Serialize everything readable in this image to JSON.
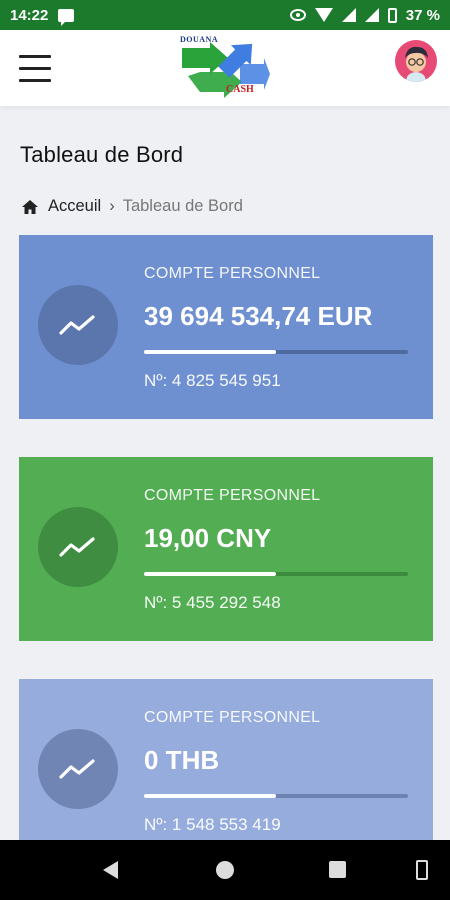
{
  "status_bar": {
    "time": "14:22",
    "battery": "37 %"
  },
  "header": {
    "logo_top": "DOUANA",
    "logo_bottom": "CASH"
  },
  "page": {
    "title": "Tableau de Bord"
  },
  "breadcrumb": {
    "home": "Acceuil",
    "separator": "›",
    "current": "Tableau de Bord"
  },
  "accounts": [
    {
      "type": "COMPTE PERSONNEL",
      "balance": "39 694 534,74 EUR",
      "number": "Nº: 4 825 545 951",
      "progress": 0.5,
      "color": "#6e8fd0",
      "circle_color": "#5a76ad",
      "track_color": "#4f6aa1"
    },
    {
      "type": "COMPTE PERSONNEL",
      "balance": "19,00 CNY",
      "number": "Nº: 5 455 292 548",
      "progress": 0.5,
      "color": "#52ad53",
      "circle_color": "#3f8d41",
      "track_color": "#3c8a3e"
    },
    {
      "type": "COMPTE PERSONNEL",
      "balance": "0 THB",
      "number": "Nº: 1 548 553 419",
      "progress": 0.5,
      "color": "#96acdd",
      "circle_color": "#7185b5",
      "track_color": "#6e82b2"
    }
  ],
  "icons": {
    "menu": "hamburger-icon",
    "home": "home-icon",
    "card": "trending-up-icon",
    "avatar": "user-avatar"
  }
}
